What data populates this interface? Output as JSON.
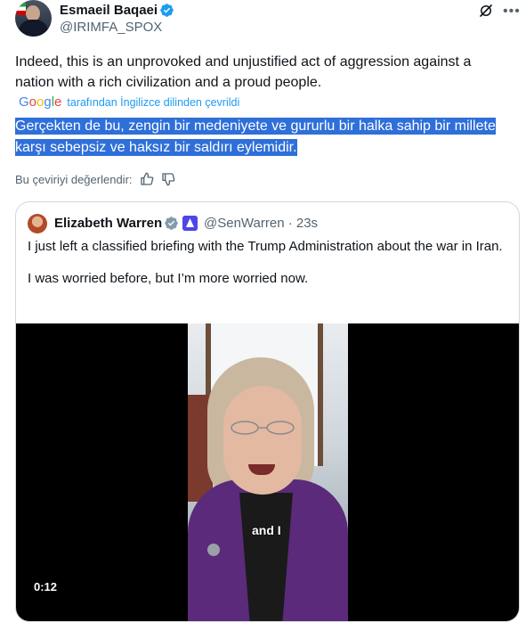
{
  "author": {
    "name": "Esmaeil Baqaei",
    "handle": "@IRIMFA_SPOX"
  },
  "tweet": {
    "text": "Indeed, this is an unprovoked and unjustified act of aggression against a nation with a rich civilization and a proud people.",
    "translated_by": "tarafından İngilizce dilinden çevrildi",
    "google_label": "Google",
    "translation": "Gerçekten de bu, zengin bir medeniyete ve gururlu bir halka sahip bir millete karşı sebepsiz ve haksız bir saldırı eylemidir.",
    "rate_label": "Bu çeviriyi değerlendir:"
  },
  "quote": {
    "name": "Elizabeth Warren",
    "handle_time": "@SenWarren · 23s",
    "paragraph1": "I just left a classified briefing with the Trump Administration about the war in Iran.",
    "paragraph2": "I was worried before, but I’m more worried now.",
    "video": {
      "caption": "and I",
      "timer": "0:12"
    }
  },
  "colors": {
    "verified": "#1d9bf0",
    "highlight": "#2f6fd9",
    "link": "#1d9bf0"
  },
  "icons": [
    "verified-icon",
    "grok-icon",
    "more-icon",
    "thumbs-up-icon",
    "thumbs-down-icon",
    "government-badge-icon"
  ]
}
